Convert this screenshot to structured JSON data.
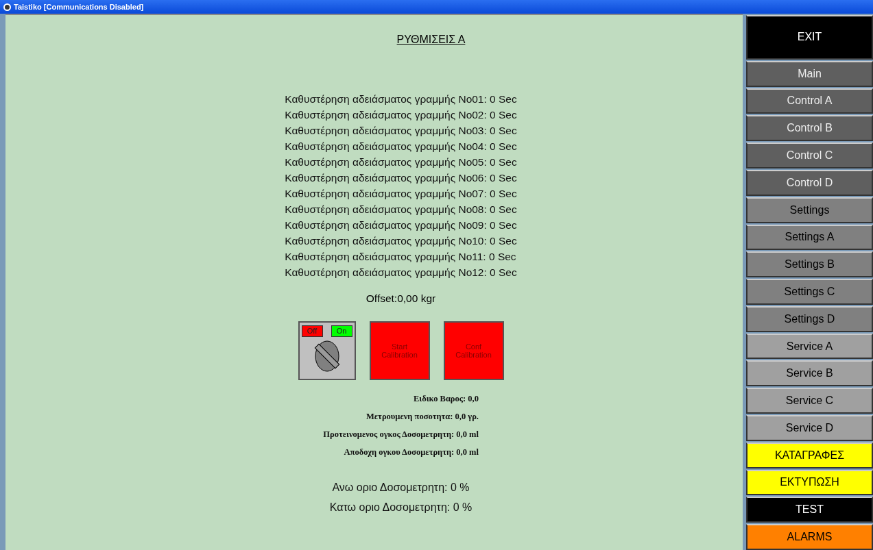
{
  "window": {
    "title": "Taistiko [Communications Disabled]"
  },
  "page_title": "ΡΥΘΜΙΣΕΙΣ Α",
  "delay_lines": [
    "Καθυστέρηση αδειάσματος γραμμής No01: 0 Sec",
    "Καθυστέρηση αδειάσματος γραμμής No02: 0 Sec",
    "Καθυστέρηση αδειάσματος γραμμής No03: 0 Sec",
    "Καθυστέρηση αδειάσματος γραμμής No04: 0 Sec",
    "Καθυστέρηση αδειάσματος γραμμής No05: 0 Sec",
    "Καθυστέρηση αδειάσματος γραμμής No06: 0 Sec",
    "Καθυστέρηση αδειάσματος γραμμής No07: 0 Sec",
    "Καθυστέρηση αδειάσματος γραμμής No08: 0 Sec",
    "Καθυστέρηση αδειάσματος γραμμής No09: 0 Sec",
    "Καθυστέρηση αδειάσματος γραμμής No10: 0 Sec",
    "Καθυστέρηση αδειάσματος γραμμής No11: 0 Sec",
    "Καθυστέρηση αδειάσματος γραμμής No12: 0 Sec"
  ],
  "offset": "Offset:0,00 kgr",
  "switch": {
    "off_label": "Off",
    "on_label": "On",
    "on": false
  },
  "buttons": [
    "Start Calibration",
    "Conf Calibration"
  ],
  "measurements": [
    "Ειδικο Βαρος: 0,0",
    "Μετρουμενη ποσοτητα: 0,0 γρ.",
    "Προτεινομενος ογκος Δοσομετρητη: 0,0 ml",
    "Αποδοχη ογκου Δοσομετρητη: 0,0 ml"
  ],
  "limits": [
    "Ανω οριο Δοσομετρητη: 0 %",
    "Κατω οριο Δοσομετρητη: 0 %"
  ],
  "nav": [
    {
      "label": "EXIT",
      "color": "#000000"
    },
    {
      "label": "Main",
      "color": "#5f5f5f"
    },
    {
      "label": "Control A",
      "color": "#5f5f5f"
    },
    {
      "label": "Control B",
      "color": "#5f5f5f"
    },
    {
      "label": "Control C",
      "color": "#5f5f5f"
    },
    {
      "label": "Control D",
      "color": "#5f5f5f"
    },
    {
      "label": "Settings",
      "color": "#808080"
    },
    {
      "label": "Settings A",
      "color": "#808080"
    },
    {
      "label": "Settings B",
      "color": "#808080"
    },
    {
      "label": "Settings C",
      "color": "#808080"
    },
    {
      "label": "Settings D",
      "color": "#808080"
    },
    {
      "label": "Service A",
      "color": "#a0a0a0"
    },
    {
      "label": "Service B",
      "color": "#a0a0a0"
    },
    {
      "label": "Service C",
      "color": "#a0a0a0"
    },
    {
      "label": "Service D",
      "color": "#a0a0a0"
    },
    {
      "label": "ΚΑΤΑΓΡΑΦΕΣ",
      "color": "#ffff00"
    },
    {
      "label": "ΕΚΤΥΠΩΣΗ",
      "color": "#ffff00"
    },
    {
      "label": "TEST",
      "color": "#000000"
    },
    {
      "label": "ALARMS",
      "color": "#ff8000"
    }
  ]
}
